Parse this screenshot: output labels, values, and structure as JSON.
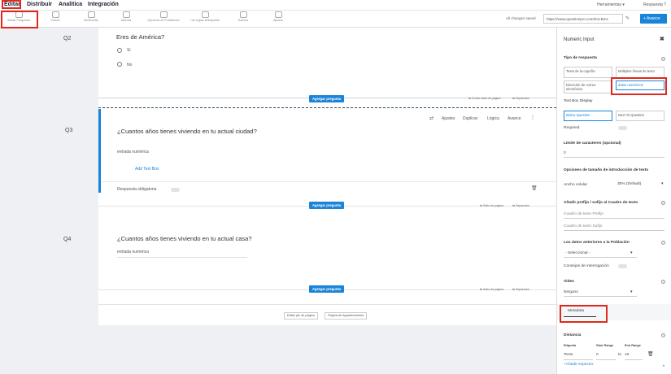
{
  "nav": {
    "tabs": [
      "Editar",
      "Distribuir",
      "Analítica",
      "Integración"
    ],
    "tools_menu": "Herramientas ▾",
    "response_menu": "Respuesta ?"
  },
  "toolbar": {
    "items": [
      "Añadir Preguntas",
      "Diseño",
      "Multimedia",
      "Idiomas",
      "Opciones de Publicación",
      "Las reglas anticipadas",
      "Sorteos",
      "Ajustes"
    ],
    "saved_text": "All changes saved",
    "url": "https://www.questionpro.com/t/ALBmx",
    "new_button": "+ Avance"
  },
  "canvas": {
    "q2": {
      "label": "Q2",
      "title": "Eres de América?",
      "options": [
        "Si",
        "No"
      ],
      "add_question": "Agregar pregunta",
      "page_break": "⇆ Cortar salto de página",
      "separator": "⇆ Separador"
    },
    "q3": {
      "label": "Q3",
      "title": "¿Cuantos años tienes viviendo en tu actual ciudad?",
      "actions": [
        "Ajustes",
        "Duplicar",
        "Lógica",
        "Avance"
      ],
      "input_label": "entrada numérica",
      "add_text": "Add Text Box",
      "required": "Respuesta obligatoria",
      "add_question": "Agregar pregunta",
      "page_break": "⇆ Salto de página",
      "separator": "⇆ Separador"
    },
    "q4": {
      "label": "Q4",
      "title": "¿Cuantos años tienes viviendo en tu actual casa?",
      "input_label": "entrada numérica",
      "add_question": "Agregar pregunta",
      "page_break": "⇆ Salto de página",
      "separator": "⇆ Separador"
    },
    "footer": {
      "edit_page": "Editar pie de página",
      "thanks_page": "Página de Agradecimiento"
    }
  },
  "panel": {
    "title": "Numeric Input",
    "response_type": "Tipo de respuesta",
    "type_options": [
      "Texto de la caja fila",
      "Múltiples líneas de texto",
      "Dirección de correo electrónico",
      "datos numéricos"
    ],
    "display_label": "Text Box Display",
    "display_options": [
      "Below Question",
      "Next To Question"
    ],
    "required": "Required",
    "char_limit": "Límite de caracteres (opcional)",
    "char_value": "0",
    "size_options": "Opciones de tamaño de introducción de texto",
    "cell_width": "Ancho celular",
    "cell_width_value": "30% (Default)",
    "prefix_suffix": "Añadir prefijo / sufijo al Cuadro de texto",
    "prefix_placeholder": "Cuadro de texto Prefijo",
    "suffix_placeholder": "Cuadro de texto Sufijo",
    "prefill": "Los datos anteriores a la Población",
    "select": "- Seleccionar -",
    "icon_consent": "Consejos de interrogación",
    "video": "Video",
    "video_value": "Ninguno",
    "metadata": "Metadata",
    "distance": "Distancia",
    "labels_header": [
      "Etiqueta",
      "Start Range",
      "End Range"
    ],
    "label_value": "Texto",
    "start_value": "0",
    "to": "to",
    "end_value": "10",
    "add_range": "+Añadir espectro"
  },
  "colors": {
    "accent": "#1a84d8",
    "highlight": "#e0281e"
  }
}
